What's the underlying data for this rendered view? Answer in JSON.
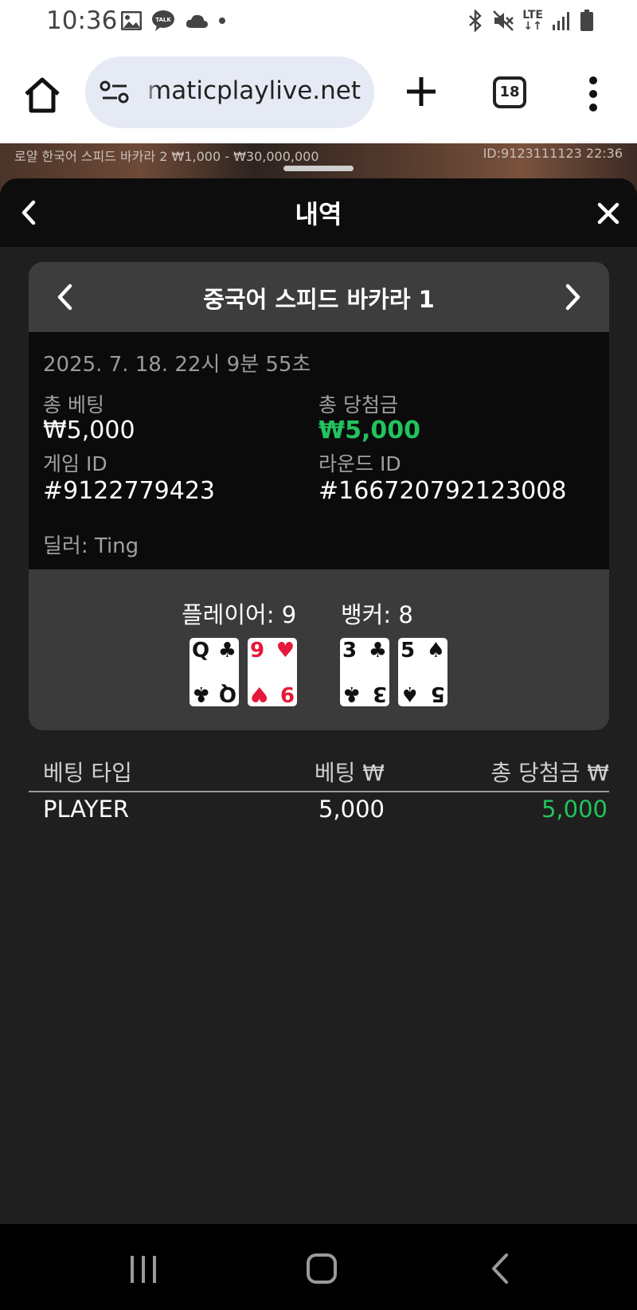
{
  "status_bar": {
    "time": "10:36",
    "network": "LTE",
    "icons": [
      "gallery-icon",
      "talk-icon",
      "cloud-icon",
      "dot-icon",
      "bluetooth-icon",
      "mute-icon",
      "signal-icon",
      "battery-icon"
    ]
  },
  "browser": {
    "url": "maticplaylive.net",
    "tab_count": "18",
    "icons": [
      "home-icon",
      "site-settings-icon",
      "plus-icon",
      "tabs-icon",
      "more-icon"
    ]
  },
  "game_strip": {
    "info": "로얄 한국어 스피드 바카라 2  ₩1,000 - ₩30,000,000",
    "id_time": "ID:9123111123  22:36"
  },
  "sheet": {
    "title": "내역"
  },
  "record": {
    "game_name": "중국어 스피드 바카라 1",
    "datetime": "2025. 7. 18. 22시 9분 55초",
    "total_bet_label": "총 베팅",
    "total_bet_value": "₩5,000",
    "total_win_label": "총 당첨금",
    "total_win_value": "₩5,000",
    "game_id_label": "게임 ID",
    "game_id_value": "#9122779423",
    "round_id_label": "라운드 ID",
    "round_id_value": "#166720792123008",
    "dealer": "딜러: Ting"
  },
  "hands": {
    "player_label": "플레이어: 9",
    "banker_label": "뱅커: 8",
    "player_cards": [
      {
        "rank": "Q",
        "suit": "♣",
        "color": "#111111"
      },
      {
        "rank": "9",
        "suit": "♥",
        "color": "#e5173a"
      }
    ],
    "banker_cards": [
      {
        "rank": "3",
        "suit": "♣",
        "color": "#111111"
      },
      {
        "rank": "5",
        "suit": "♠",
        "color": "#111111"
      }
    ]
  },
  "bets_table": {
    "headers": [
      "베팅 타입",
      "베팅 ₩",
      "총 당첨금 ₩"
    ],
    "rows": [
      {
        "type": "PLAYER",
        "bet": "5,000",
        "win": "5,000"
      }
    ]
  },
  "colors": {
    "win_green": "#22c35e",
    "sheet_bg": "#1f1f1f",
    "card_bg": "#3b3b3b"
  }
}
